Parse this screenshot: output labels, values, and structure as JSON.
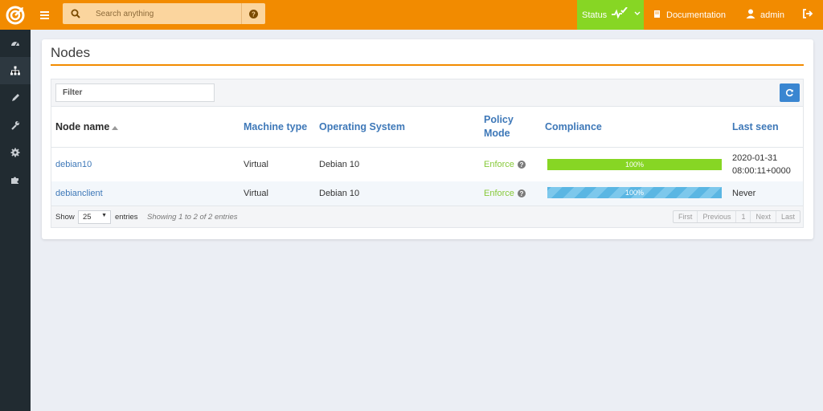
{
  "colors": {
    "brand": "#f28b00",
    "status_ok": "#87d624",
    "link": "#3e78b8",
    "sidebar": "#212b31",
    "refresh_button": "#3a86d1"
  },
  "header": {
    "logo_icon": "target-logo-icon",
    "menu_icon": "hamburger-icon",
    "search_icon": "search-icon",
    "search_placeholder": "Search anything",
    "search_help_icon": "question-circle-icon",
    "status_label": "Status",
    "status_icon": "heartbeat-check-icon",
    "documentation_label": "Documentation",
    "documentation_icon": "book-icon",
    "user_label": "admin",
    "user_icon": "user-icon",
    "logout_icon": "sign-out-icon"
  },
  "sidebar": {
    "items": [
      {
        "icon": "dashboard-icon",
        "active": false
      },
      {
        "icon": "sitemap-icon",
        "active": true
      },
      {
        "icon": "pencil-icon",
        "active": false
      },
      {
        "icon": "wrench-icon",
        "active": false
      },
      {
        "icon": "gear-icon",
        "active": false
      },
      {
        "icon": "puzzle-icon",
        "active": false
      }
    ]
  },
  "page": {
    "title": "Nodes",
    "filter_placeholder": "Filter",
    "refresh_icon": "refresh-icon"
  },
  "table": {
    "columns": [
      "Node name",
      "Machine type",
      "Operating System",
      "Policy Mode",
      "Compliance",
      "Last seen"
    ],
    "sort_column": "Node name",
    "sort_direction": "asc",
    "rows": [
      {
        "name": "debian10",
        "machine": "Virtual",
        "os": "Debian 10",
        "policy": "Enforce",
        "compliance": "100%",
        "compliance_value": 100,
        "compliance_state": "success",
        "last_seen": "2020-01-31",
        "last_seen_time": "08:00:11+0000"
      },
      {
        "name": "debianclient",
        "machine": "Virtual",
        "os": "Debian 10",
        "policy": "Enforce",
        "compliance": "100%",
        "compliance_value": 100,
        "compliance_state": "pending",
        "last_seen": "Never",
        "last_seen_time": ""
      }
    ]
  },
  "footer": {
    "show_label": "Show",
    "page_size": "25",
    "entries_label": "entries",
    "info": "Showing 1 to 2 of 2 entries",
    "pager": [
      "First",
      "Previous",
      "1",
      "Next",
      "Last"
    ]
  }
}
